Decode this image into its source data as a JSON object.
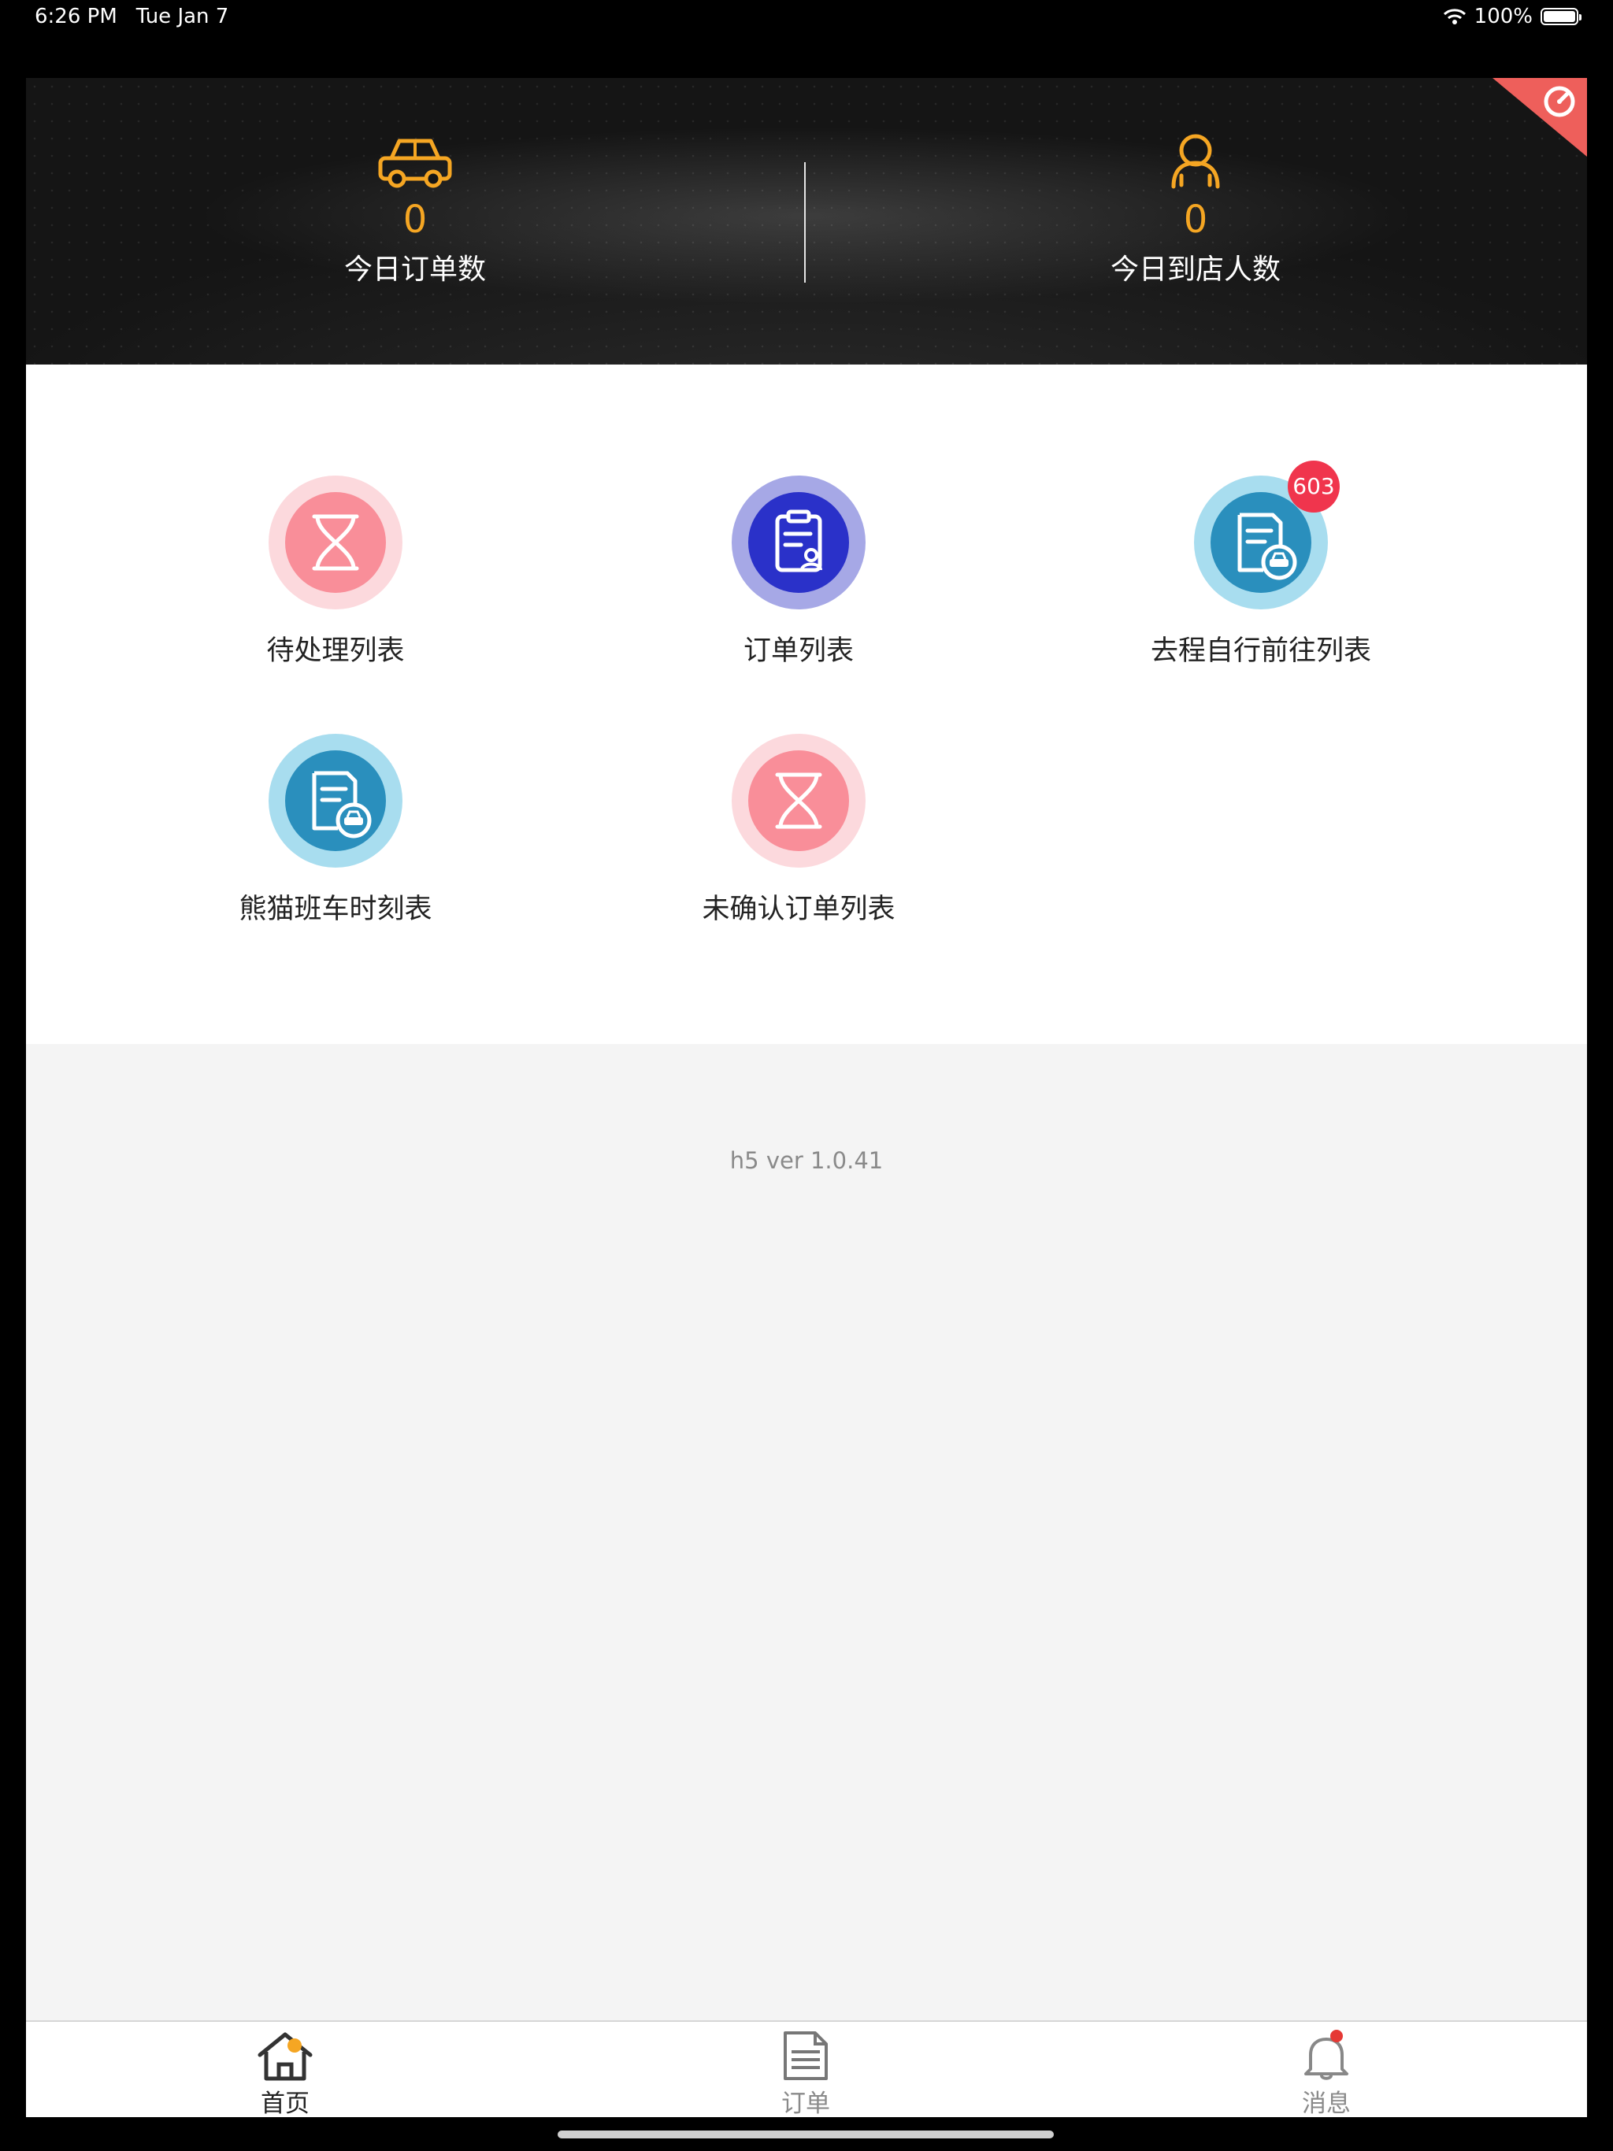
{
  "status_bar": {
    "time": "6:26 PM",
    "date": "Tue Jan 7",
    "battery": "100%"
  },
  "hero": {
    "stats": [
      {
        "icon": "car-icon",
        "value": "0",
        "label": "今日订单数"
      },
      {
        "icon": "person-icon",
        "value": "0",
        "label": "今日到店人数"
      }
    ],
    "corner_icon": "timer-icon",
    "accent_color": "#f5a623"
  },
  "menu": {
    "items": [
      {
        "label": "待处理列表",
        "icon": "hourglass-icon",
        "badge": ""
      },
      {
        "label": "订单列表",
        "icon": "clipboard-user-icon",
        "badge": ""
      },
      {
        "label": "去程自行前往列表",
        "icon": "document-car-icon",
        "badge": "603"
      },
      {
        "label": "熊猫班车时刻表",
        "icon": "document-car-icon",
        "badge": ""
      },
      {
        "label": "未确认订单列表",
        "icon": "hourglass-icon",
        "badge": ""
      }
    ]
  },
  "footer": {
    "version": "h5 ver 1.0.41"
  },
  "tabbar": {
    "items": [
      {
        "label": "首页",
        "icon": "home-icon",
        "active": true
      },
      {
        "label": "订单",
        "icon": "document-icon",
        "active": false
      },
      {
        "label": "消息",
        "icon": "bell-icon",
        "active": false
      }
    ]
  }
}
